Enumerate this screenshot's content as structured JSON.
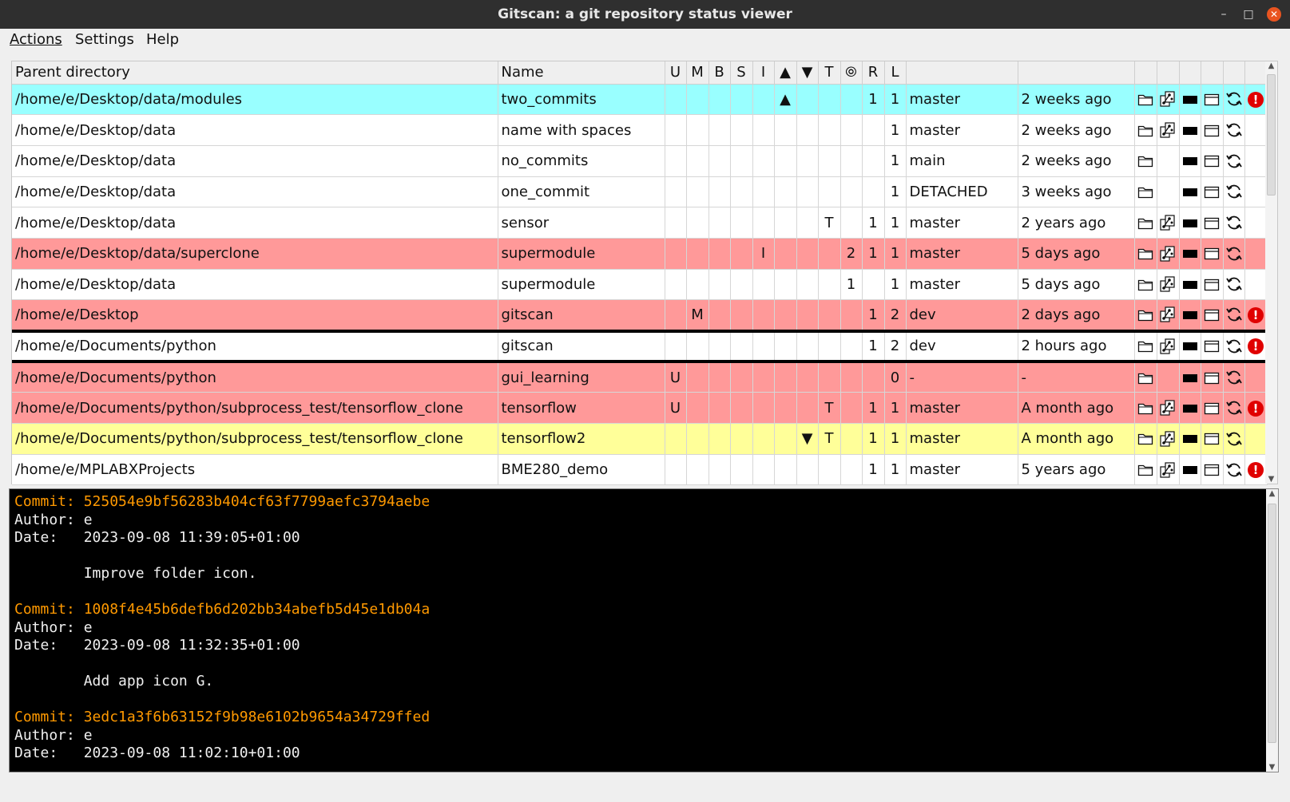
{
  "window": {
    "title": "Gitscan:  a git repository status viewer"
  },
  "menubar": {
    "items": [
      "Actions",
      "Settings",
      "Help"
    ]
  },
  "table": {
    "columns": [
      "Parent directory",
      "Name",
      "U",
      "M",
      "B",
      "S",
      "I",
      "▲",
      "▼",
      "T",
      "⦾",
      "R",
      "L",
      "",
      ""
    ],
    "rows": [
      {
        "color": "cyan",
        "parent": "/home/e/Desktop/data/modules",
        "name": "two_commits",
        "U": "",
        "M": "",
        "B": "",
        "S": "",
        "I": "",
        "ahead": "▲",
        "behind": "",
        "T": "",
        "sub": "",
        "R": "1",
        "L": "1",
        "branch": "master",
        "time": "2 weeks ago",
        "icons": [
          "folder",
          "gitk",
          "terminal",
          "window",
          "refresh",
          "error"
        ]
      },
      {
        "color": "white",
        "parent": "/home/e/Desktop/data",
        "name": "name with spaces",
        "U": "",
        "M": "",
        "B": "",
        "S": "",
        "I": "",
        "ahead": "",
        "behind": "",
        "T": "",
        "sub": "",
        "R": "",
        "L": "1",
        "branch": "master",
        "time": "2 weeks ago",
        "icons": [
          "folder",
          "gitk",
          "terminal",
          "window",
          "refresh"
        ]
      },
      {
        "color": "white",
        "parent": "/home/e/Desktop/data",
        "name": "no_commits",
        "U": "",
        "M": "",
        "B": "",
        "S": "",
        "I": "",
        "ahead": "",
        "behind": "",
        "T": "",
        "sub": "",
        "R": "",
        "L": "1",
        "branch": "main",
        "time": "2 weeks ago",
        "icons": [
          "folder",
          "",
          "terminal",
          "window",
          "refresh"
        ]
      },
      {
        "color": "white",
        "parent": "/home/e/Desktop/data",
        "name": "one_commit",
        "U": "",
        "M": "",
        "B": "",
        "S": "",
        "I": "",
        "ahead": "",
        "behind": "",
        "T": "",
        "sub": "",
        "R": "",
        "L": "1",
        "branch": "DETACHED",
        "time": "3 weeks ago",
        "icons": [
          "folder",
          "",
          "terminal",
          "window",
          "refresh"
        ]
      },
      {
        "color": "white",
        "parent": "/home/e/Desktop/data",
        "name": "sensor",
        "U": "",
        "M": "",
        "B": "",
        "S": "",
        "I": "",
        "ahead": "",
        "behind": "",
        "T": "T",
        "sub": "",
        "R": "1",
        "L": "1",
        "branch": "master",
        "time": "2 years ago",
        "icons": [
          "folder",
          "gitk",
          "terminal",
          "window",
          "refresh"
        ]
      },
      {
        "color": "red",
        "parent": "/home/e/Desktop/data/superclone",
        "name": "supermodule",
        "U": "",
        "M": "",
        "B": "",
        "S": "",
        "I": "I",
        "ahead": "",
        "behind": "",
        "T": "",
        "sub": "2",
        "R": "1",
        "L": "1",
        "branch": "master",
        "time": "5 days ago",
        "icons": [
          "folder",
          "gitk",
          "terminal",
          "window",
          "refresh"
        ]
      },
      {
        "color": "white",
        "parent": "/home/e/Desktop/data",
        "name": "supermodule",
        "U": "",
        "M": "",
        "B": "",
        "S": "",
        "I": "",
        "ahead": "",
        "behind": "",
        "T": "",
        "sub": "1",
        "R": "",
        "L": "1",
        "branch": "master",
        "time": "5 days ago",
        "icons": [
          "folder",
          "gitk",
          "terminal",
          "window",
          "refresh"
        ]
      },
      {
        "color": "red",
        "parent": "/home/e/Desktop",
        "name": "gitscan",
        "U": "",
        "M": "M",
        "B": "",
        "S": "",
        "I": "",
        "ahead": "",
        "behind": "",
        "T": "",
        "sub": "",
        "R": "1",
        "L": "2",
        "branch": "dev",
        "time": "2 days ago",
        "icons": [
          "folder",
          "gitk",
          "terminal",
          "window",
          "refresh",
          "error"
        ]
      },
      {
        "color": "white",
        "selected": true,
        "parent": "/home/e/Documents/python",
        "name": "gitscan",
        "U": "",
        "M": "",
        "B": "",
        "S": "",
        "I": "",
        "ahead": "",
        "behind": "",
        "T": "",
        "sub": "",
        "R": "1",
        "L": "2",
        "branch": "dev",
        "time": "2 hours ago",
        "icons": [
          "folder",
          "gitk",
          "terminal",
          "window",
          "refresh",
          "error"
        ]
      },
      {
        "color": "red",
        "parent": "/home/e/Documents/python",
        "name": "gui_learning",
        "U": "U",
        "M": "",
        "B": "",
        "S": "",
        "I": "",
        "ahead": "",
        "behind": "",
        "T": "",
        "sub": "",
        "R": "",
        "L": "0",
        "branch": "-",
        "time": "-",
        "icons": [
          "folder",
          "",
          "terminal",
          "window",
          "refresh"
        ]
      },
      {
        "color": "red",
        "parent": "/home/e/Documents/python/subprocess_test/tensorflow_clone",
        "name": "tensorflow",
        "U": "U",
        "M": "",
        "B": "",
        "S": "",
        "I": "",
        "ahead": "",
        "behind": "",
        "T": "T",
        "sub": "",
        "R": "1",
        "L": "1",
        "branch": "master",
        "time": "A month ago",
        "icons": [
          "folder",
          "gitk",
          "terminal",
          "window",
          "refresh",
          "error"
        ]
      },
      {
        "color": "yellow",
        "parent": "/home/e/Documents/python/subprocess_test/tensorflow_clone",
        "name": "tensorflow2",
        "U": "",
        "M": "",
        "B": "",
        "S": "",
        "I": "",
        "ahead": "",
        "behind": "▼",
        "T": "T",
        "sub": "",
        "R": "1",
        "L": "1",
        "branch": "master",
        "time": "A month ago",
        "icons": [
          "folder",
          "gitk",
          "terminal",
          "window",
          "refresh"
        ]
      },
      {
        "color": "white",
        "parent": "/home/e/MPLABXProjects",
        "name": "BME280_demo",
        "U": "",
        "M": "",
        "B": "",
        "S": "",
        "I": "",
        "ahead": "",
        "behind": "",
        "T": "",
        "sub": "",
        "R": "1",
        "L": "1",
        "branch": "master",
        "time": "5 years ago",
        "icons": [
          "folder",
          "gitk",
          "terminal",
          "window",
          "refresh",
          "error"
        ]
      }
    ]
  },
  "log": {
    "entries": [
      {
        "commit": "Commit: 525054e9bf56283b404cf63f7799aefc3794aebe",
        "author": "Author: e",
        "date": "Date:   2023-09-08 11:39:05+01:00",
        "message": "        Improve folder icon."
      },
      {
        "commit": "Commit: 1008f4e45b6defb6d202bb34abefb5d45e1db04a",
        "author": "Author: e",
        "date": "Date:   2023-09-08 11:32:35+01:00",
        "message": "        Add app icon G."
      },
      {
        "commit": "Commit: 3edc1a3f6b63152f9b98e6102b9654a34729ffed",
        "author": "Author: e",
        "date": "Date:   2023-09-08 11:02:10+01:00",
        "message": ""
      }
    ]
  },
  "colors": {
    "cyan": "#99ffff",
    "red": "#ff9999",
    "yellow": "#ffff99",
    "commit": "#ff9900",
    "error": "#e00000"
  }
}
